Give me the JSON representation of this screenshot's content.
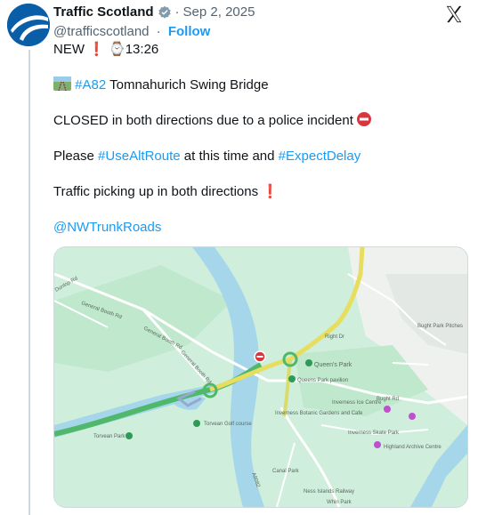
{
  "tweet": {
    "display_name": "Traffic Scotland",
    "date": "Sep 2, 2025",
    "handle": "@trafficscotland",
    "follow_label": "Follow",
    "line1_prefix": "NEW",
    "line1_time": "13:26",
    "line2_hashtag": "#A82",
    "line2_text": " Tomnahurich Swing Bridge",
    "line3_text": "CLOSED in both directions due to a police incident",
    "line4_a": "Please ",
    "line4_hashtag1": "#UseAltRoute",
    "line4_b": " at this time and ",
    "line4_hashtag2": "#ExpectDelay",
    "line5_text": "Traffic picking up in both directions",
    "mention": "@NWTrunkRoads"
  },
  "map": {
    "labels": {
      "general_booth_rd_1": "General Booth Rd",
      "general_booth_rd_2": "General Booth Rd",
      "general_booth_rd_3": "General Booth Rd",
      "dunlop_rd": "Dunlop Rd",
      "queens_park": "Queen's Park",
      "queens_park_pavilion": "Queens Park pavilion",
      "bught_park_pitches": "Bught Park Pitches",
      "inverness_ice_centre": "Inverness Ice Centre",
      "inverness_botanic": "Inverness Botanic Gardens and Cafe",
      "inverness_skate_park": "Inverness Skate Park",
      "highland_archive": "Highland Archive Centre",
      "torvean_park": "Torvean Park",
      "torvean_golf": "Torvean Golf course",
      "canal_park": "Canal Park",
      "ness_islands_railway": "Ness Islands Railway",
      "whin_park": "Whin Park",
      "bught_rd": "Bught Rd",
      "a8082": "A8082",
      "bridge_rd": "Bught Rd",
      "right_dr": "Right Dr"
    }
  },
  "colors": {
    "link": "#1d9bf0",
    "map_land": "#cfeedc",
    "map_water": "#a5d6ea",
    "road_yellow": "#e7dd5f",
    "road_green": "#4fb86a",
    "closure": "#d9363e"
  },
  "icons": [
    "verified-badge-icon",
    "x-logo-icon",
    "exclamation-icon",
    "watch-icon",
    "railway-track-icon",
    "no-entry-icon",
    "park-pin-icon"
  ]
}
